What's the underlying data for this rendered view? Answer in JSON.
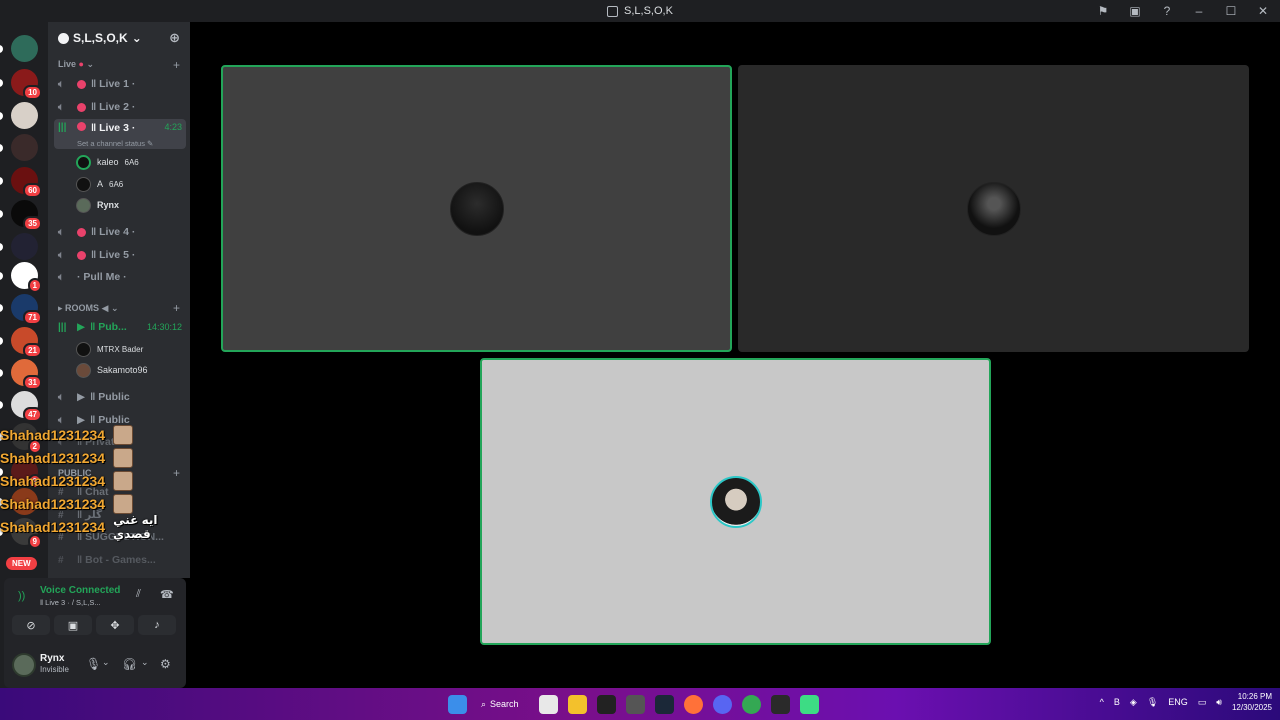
{
  "window": {
    "title": "S,L,S,O,K"
  },
  "servers": [
    {
      "name": "server-1",
      "badge": "",
      "color": "#2e6b5a"
    },
    {
      "name": "server-2",
      "badge": "10",
      "color": "#8a1a1a"
    },
    {
      "name": "server-3",
      "badge": "",
      "color": "#d8d0c8"
    },
    {
      "name": "server-4",
      "badge": "",
      "color": "#3a2a2a"
    },
    {
      "name": "server-5",
      "badge": "60",
      "color": "#6a1010"
    },
    {
      "name": "server-6",
      "badge": "35",
      "color": "#0a0a0a"
    },
    {
      "name": "server-7",
      "badge": "",
      "color": "#223"
    },
    {
      "name": "server-8",
      "badge": "1",
      "color": "#fff"
    },
    {
      "name": "server-9",
      "badge": "71",
      "color": "#1a3a6a"
    },
    {
      "name": "server-10",
      "badge": "21",
      "color": "#c84a2a"
    },
    {
      "name": "server-11",
      "badge": "31",
      "color": "#e06a3a"
    },
    {
      "name": "server-12",
      "badge": "47",
      "color": "#ddd"
    },
    {
      "name": "server-13",
      "badge": "2",
      "color": "#333"
    },
    {
      "name": "server-14",
      "badge": "9",
      "color": "#5a1a1a"
    },
    {
      "name": "server-15",
      "badge": "",
      "color": "#8a3a1a"
    },
    {
      "name": "server-16",
      "badge": "9",
      "color": "#3a3a3a"
    }
  ],
  "new_badge": "NEW",
  "guild": {
    "name": "S,L,S,O,K"
  },
  "categories": {
    "live": "Live",
    "rooms": "ROOMS ◀",
    "public": "PUBLIC"
  },
  "channels": {
    "live1": "ǁ Live 1 ·",
    "live2": "ǁ Live 2 ·",
    "live3": "ǁ Live 3 ·",
    "live3_time": "4:23",
    "live3_status": "Set a channel status",
    "live4": "ǁ Live 4 ·",
    "live5": "ǁ Live 5 ·",
    "pullme": "· Pull Me ·",
    "pub": "ǁ Pub...",
    "pub_time": "14:30:12",
    "public1": "ǁ Public",
    "public2": "ǁ Public",
    "private": "ǁ Private",
    "chat": "ǁ Chat",
    "text2": "ǁ ﮔﻠﺮ",
    "suggestion": "ǁ SUGGESTION...",
    "bot": "ǁ Bot - Games..."
  },
  "members": {
    "m1": "kaleo",
    "m1_extra": "6A6",
    "m2": "A",
    "m2_extra": "6A6",
    "m3": "Rynx",
    "m4": "MTRX Bader",
    "m5": "Sakamoto96"
  },
  "overlay": {
    "names": [
      "Shahad1231234",
      "Shahad1231234",
      "Shahad1231234",
      "Shahad1231234",
      "Shahad1231234"
    ],
    "message": "ايه غني قصدي"
  },
  "voice": {
    "status": "Voice Connected",
    "channel": "ǁ Live 3 · / S,L,S..."
  },
  "user": {
    "name": "Rynx",
    "status": "Invisible"
  },
  "taskbar": {
    "search": "Search",
    "lang": "ENG",
    "time": "10:26 PM",
    "date": "12/30/2025"
  },
  "colors": {
    "accent_green": "#23a559",
    "live_dot": "#e9426b",
    "sidebar": "#2b2d31",
    "rail": "#1e1f22",
    "overlay_name": "#f0a732"
  }
}
